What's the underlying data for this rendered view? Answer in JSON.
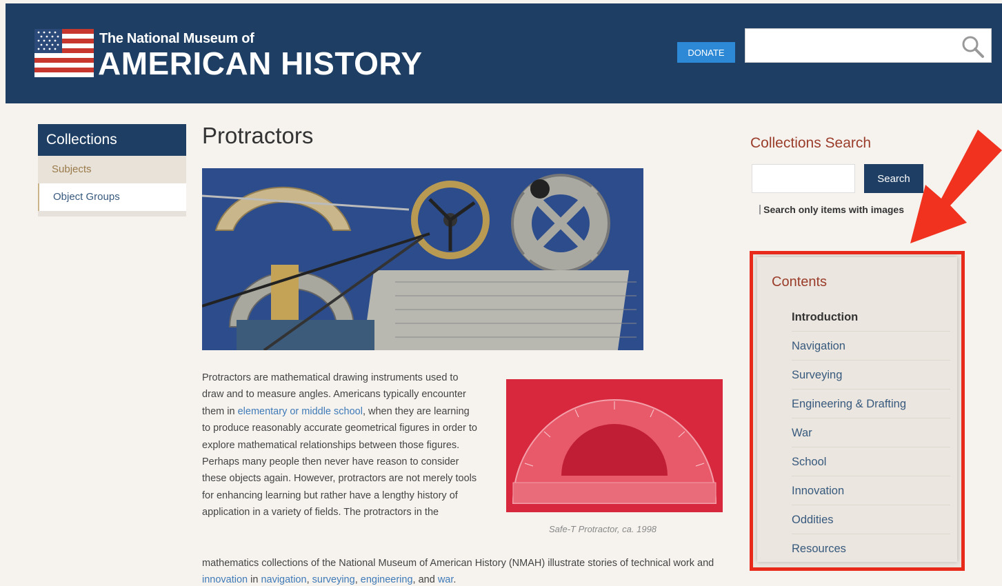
{
  "header": {
    "brand_small": "The National Museum of",
    "brand_big": "AMERICAN HISTORY",
    "donate_label": "DONATE",
    "search_placeholder": ""
  },
  "left_nav": {
    "title": "Collections",
    "items": [
      {
        "label": "Subjects"
      },
      {
        "label": "Object Groups"
      }
    ]
  },
  "main": {
    "title": "Protractors",
    "intro_parts": [
      "Protractors are mathematical drawing instruments used to draw and to measure angles. Americans typically encounter them in ",
      "elementary or middle school",
      ", when they are learning to produce reasonably accurate geometrical figures in order to explore mathematical relationships between those figures. Perhaps many people then never have reason to consider these objects again. However, protractors are not merely tools for enhancing learning but rather have a lengthy history of application in a variety of fields. The protractors in the"
    ],
    "tail_parts": [
      "mathematics collections of the National Museum of American History (NMAH) illustrate stories of technical work and ",
      "innovation",
      " in ",
      "navigation",
      ", ",
      "surveying",
      ", ",
      "engineering",
      ", and ",
      "war",
      "."
    ],
    "image_caption": "Safe-T Protractor, ca. 1998"
  },
  "sidebar": {
    "collections_search_title": "Collections Search",
    "search_button_label": "Search",
    "checkbox_label": "Search only items with images"
  },
  "contents": {
    "title": "Contents",
    "items": [
      {
        "label": "Introduction",
        "active": true
      },
      {
        "label": "Navigation"
      },
      {
        "label": "Surveying"
      },
      {
        "label": "Engineering & Drafting"
      },
      {
        "label": "War"
      },
      {
        "label": "School"
      },
      {
        "label": "Innovation"
      },
      {
        "label": "Oddities"
      },
      {
        "label": "Resources"
      }
    ]
  },
  "colors": {
    "header_bg": "#1e3f63",
    "donate_bg": "#2d89d6",
    "highlight_red": "#e82a1b",
    "link_blue": "#3f7ab7",
    "accent_rust": "#9a3c2a"
  }
}
